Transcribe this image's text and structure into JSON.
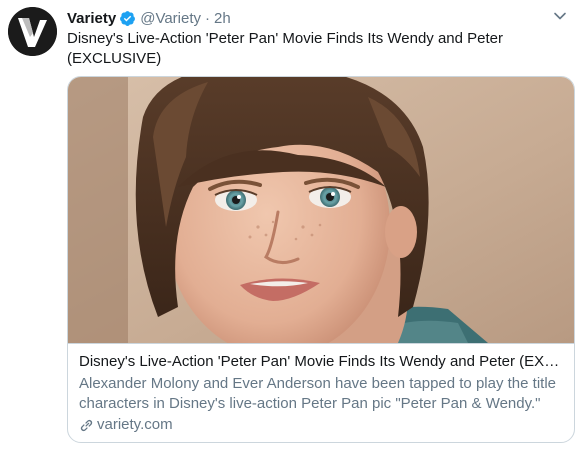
{
  "tweet": {
    "author_name": "Variety",
    "handle": "@Variety",
    "separator": "·",
    "timestamp": "2h",
    "text": "Disney's Live-Action 'Peter Pan' Movie Finds Its Wendy and Peter (EXCLUSIVE)",
    "avatar_icon": "variety-logo-icon",
    "verified_icon": "verified-badge-icon",
    "menu_icon": "chevron-down-icon"
  },
  "card": {
    "image_alt": "Close-up portrait of a boy with shaggy brown hair and blue eyes",
    "title": "Disney's Live-Action 'Peter Pan' Movie Finds Its Wendy and Peter (EXCL...",
    "description": "Alexander Molony and Ever Anderson have been tapped to play the title characters in Disney's live-action Peter Pan pic \"Peter Pan & Wendy.\"",
    "domain": "variety.com",
    "link_icon": "link-icon"
  },
  "colors": {
    "text_primary": "#14171a",
    "text_secondary": "#657786",
    "verified_blue": "#1da1f2",
    "border": "#ccd6dd"
  }
}
